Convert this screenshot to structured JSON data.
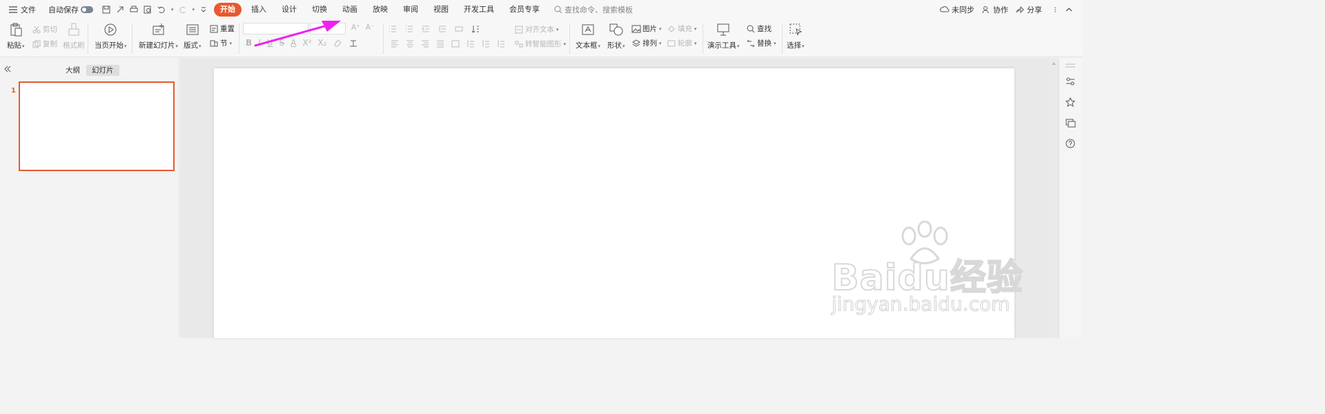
{
  "menubar": {
    "file": "文件",
    "autosave": "自动保存",
    "tabs": [
      "开始",
      "插入",
      "设计",
      "切换",
      "动画",
      "放映",
      "审阅",
      "视图",
      "开发工具",
      "会员专享"
    ],
    "search_placeholder": "查找命令、搜索模板",
    "sync": "未同步",
    "collab": "协作",
    "share": "分享"
  },
  "ribbon": {
    "paste": "粘贴",
    "cut": "剪切",
    "copy": "复制",
    "format_painter": "格式刷",
    "play_from_current": "当页开始",
    "new_slide": "新建幻灯片",
    "layout": "版式",
    "reset": "重置",
    "section": "节",
    "align_text": "对齐文本",
    "to_smartart": "转智能图形",
    "textbox": "文本框",
    "shapes": "形状",
    "picture": "图片",
    "arrange": "排列",
    "fill": "填充",
    "outline": "轮廓",
    "present_tools": "演示工具",
    "find": "查找",
    "replace": "替换",
    "select": "选择",
    "font_buttons": [
      "B",
      "I",
      "U",
      "S",
      "A",
      "X²",
      "X₂"
    ],
    "grow_font": "A⁺",
    "shrink_font": "A⁻"
  },
  "left_panel": {
    "tab_outline": "大纲",
    "tab_slides": "幻灯片",
    "slide_number": "1"
  },
  "watermark": {
    "brand": "Baidu经验",
    "url": "jingyan.baidu.com"
  },
  "colors": {
    "accent": "#e8592f",
    "annotation_arrow": "#ee22ee"
  }
}
